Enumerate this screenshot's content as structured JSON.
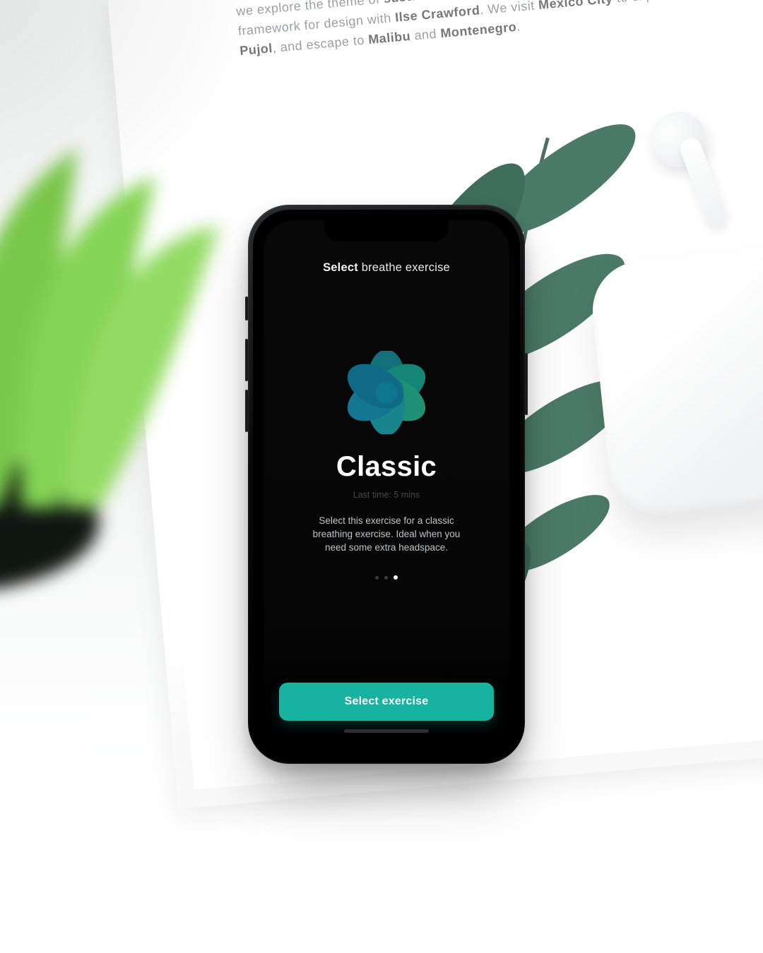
{
  "colors": {
    "accent": "#17b3a0"
  },
  "header": {
    "bold": "Select",
    "rest": " breathe exercise"
  },
  "exercise": {
    "icon_name": "breathe-flower-icon",
    "title": "Classic",
    "last_time": "Last time: 5 mins",
    "description": "Select this exercise for a classic breathing exercise. Ideal when you need some extra headspace."
  },
  "pager": {
    "count": 3,
    "active_index": 2
  },
  "cta": {
    "label": "Select exercise"
  }
}
